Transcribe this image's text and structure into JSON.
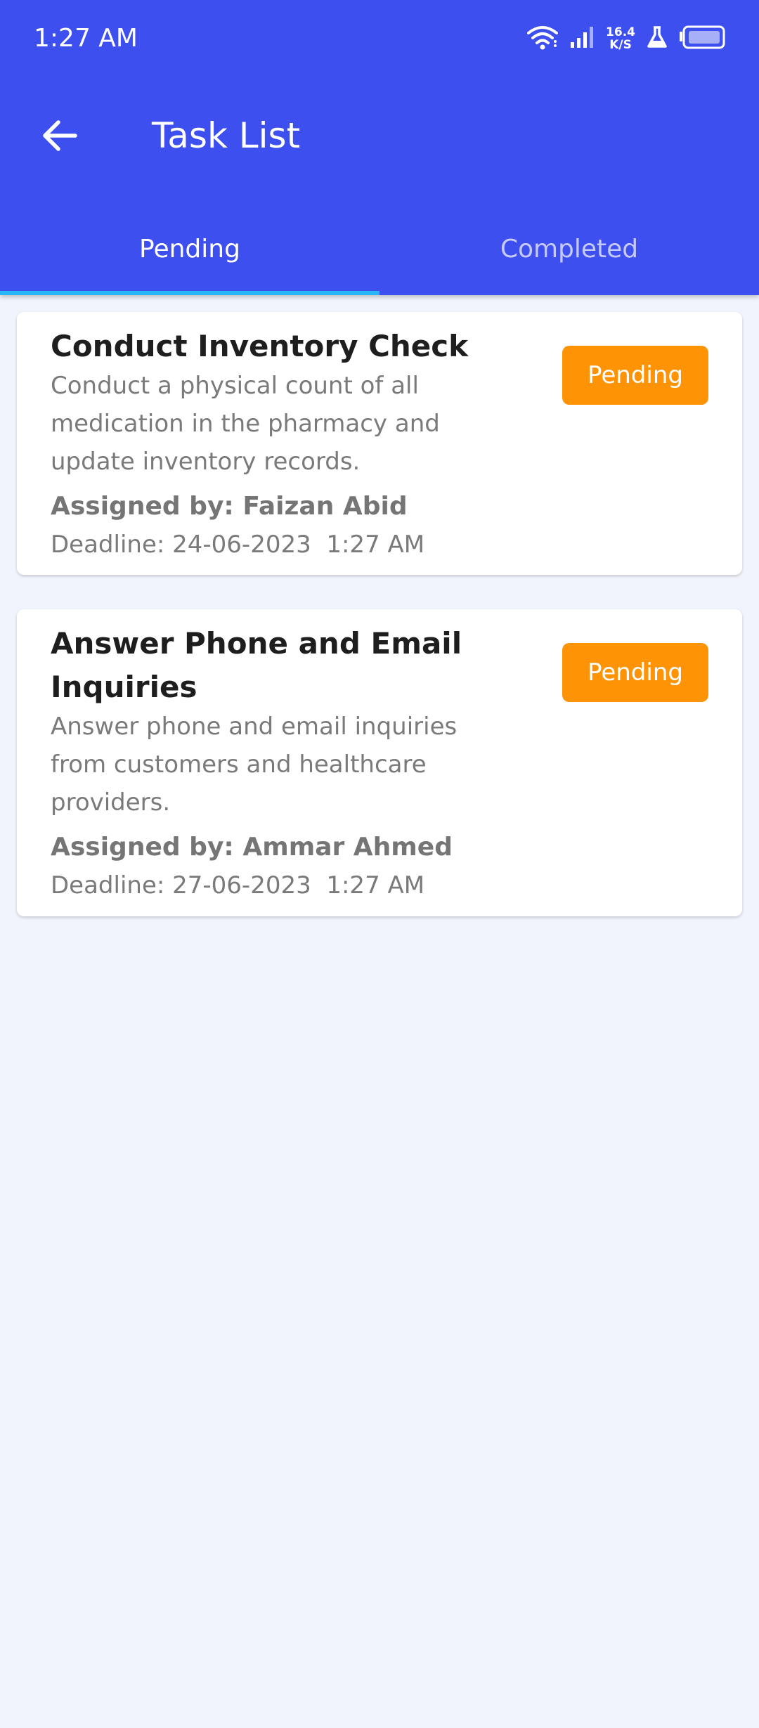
{
  "status_bar": {
    "time": "1:27 AM",
    "net_speed_value": "16.4",
    "net_speed_unit": "K/S",
    "icons": [
      "wifi-icon",
      "signal-icon",
      "lab-flask-icon",
      "battery-icon"
    ]
  },
  "header": {
    "back_icon": "arrow-left-icon",
    "title": "Task List"
  },
  "tabs": [
    {
      "label": "Pending",
      "active": true
    },
    {
      "label": "Completed",
      "active": false
    }
  ],
  "tasks": [
    {
      "title": "Conduct Inventory Check",
      "description": "Conduct a physical count of all medication in the pharmacy and update inventory records.",
      "assigned_by": "Assigned by: Faizan Abid",
      "deadline": "Deadline: 24-06-2023  1:27 AM",
      "status": "Pending"
    },
    {
      "title": "Answer Phone and Email Inquiries",
      "description": "Answer phone and email inquiries from customers and healthcare providers.",
      "assigned_by": "Assigned by: Ammar Ahmed",
      "deadline": "Deadline: 27-06-2023  1:27 AM",
      "status": "Pending"
    }
  ],
  "colors": {
    "app_bar": "#3D4FEF",
    "tab_indicator": "#29B6F6",
    "status_badge": "#FF9306",
    "background": "#F2F4FD"
  }
}
